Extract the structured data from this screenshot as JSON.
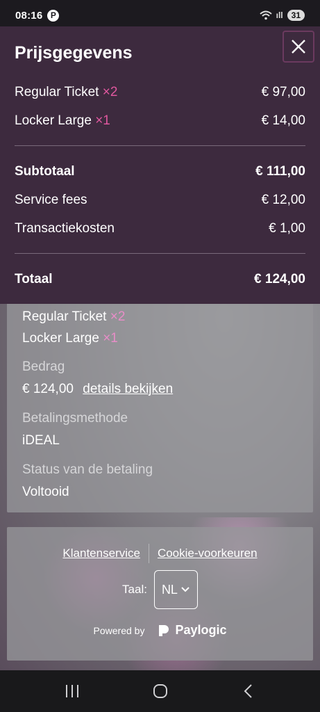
{
  "status": {
    "time": "08:16",
    "pin_glyph": "P",
    "signal": "ıll",
    "battery": "31"
  },
  "modal": {
    "title": "Prijsgegevens",
    "items": [
      {
        "name": "Regular Ticket",
        "qty": "×2",
        "price": "€ 97,00"
      },
      {
        "name": "Locker Large",
        "qty": "×1",
        "price": "€ 14,00"
      }
    ],
    "subtotal": {
      "label": "Subtotaal",
      "value": "€ 111,00"
    },
    "service_fees": {
      "label": "Service fees",
      "value": "€ 12,00"
    },
    "transaction": {
      "label": "Transactiekosten",
      "value": "€ 1,00"
    },
    "total": {
      "label": "Totaal",
      "value": "€ 124,00"
    }
  },
  "order": {
    "items": [
      {
        "name": "Regular Ticket",
        "qty": "×2"
      },
      {
        "name": "Locker Large",
        "qty": "×1"
      }
    ],
    "amount_label": "Bedrag",
    "amount_value": "€ 124,00",
    "details_link": "details bekijken",
    "method_label": "Betalingsmethode",
    "method_value": "iDEAL",
    "status_label": "Status van de betaling",
    "status_value": "Voltooid"
  },
  "footer": {
    "customer_service": "Klantenservice",
    "cookie_prefs": "Cookie-voorkeuren",
    "language_label": "Taal:",
    "language_value": "NL",
    "powered_by": "Powered by",
    "brand": "Paylogic"
  },
  "colors": {
    "modal_bg": "#3d2a3e",
    "accent_qty": "#e0589f",
    "close_border": "#6b3a5f"
  }
}
